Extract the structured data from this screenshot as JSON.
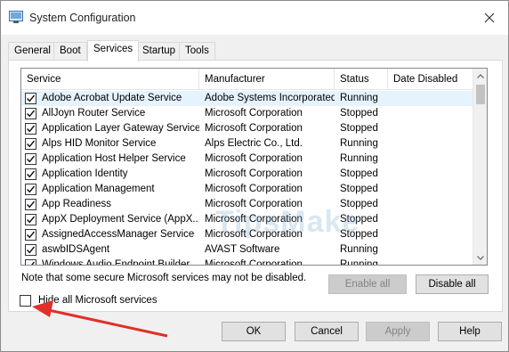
{
  "window": {
    "title": "System Configuration"
  },
  "tabs": [
    {
      "label": "General"
    },
    {
      "label": "Boot"
    },
    {
      "label": "Services",
      "active": true
    },
    {
      "label": "Startup"
    },
    {
      "label": "Tools"
    }
  ],
  "columns": [
    "Service",
    "Manufacturer",
    "Status",
    "Date Disabled"
  ],
  "services": [
    {
      "checked": true,
      "name": "Adobe Acrobat Update Service",
      "manufacturer": "Adobe Systems Incorporated",
      "status": "Running",
      "date_disabled": ""
    },
    {
      "checked": true,
      "name": "AllJoyn Router Service",
      "manufacturer": "Microsoft Corporation",
      "status": "Stopped",
      "date_disabled": ""
    },
    {
      "checked": true,
      "name": "Application Layer Gateway Service",
      "manufacturer": "Microsoft Corporation",
      "status": "Stopped",
      "date_disabled": ""
    },
    {
      "checked": true,
      "name": "Alps HID Monitor Service",
      "manufacturer": "Alps Electric Co., Ltd.",
      "status": "Running",
      "date_disabled": ""
    },
    {
      "checked": true,
      "name": "Application Host Helper Service",
      "manufacturer": "Microsoft Corporation",
      "status": "Running",
      "date_disabled": ""
    },
    {
      "checked": true,
      "name": "Application Identity",
      "manufacturer": "Microsoft Corporation",
      "status": "Stopped",
      "date_disabled": ""
    },
    {
      "checked": true,
      "name": "Application Management",
      "manufacturer": "Microsoft Corporation",
      "status": "Stopped",
      "date_disabled": ""
    },
    {
      "checked": true,
      "name": "App Readiness",
      "manufacturer": "Microsoft Corporation",
      "status": "Stopped",
      "date_disabled": ""
    },
    {
      "checked": true,
      "name": "AppX Deployment Service (AppX...",
      "manufacturer": "Microsoft Corporation",
      "status": "Stopped",
      "date_disabled": ""
    },
    {
      "checked": true,
      "name": "AssignedAccessManager Service",
      "manufacturer": "Microsoft Corporation",
      "status": "Stopped",
      "date_disabled": ""
    },
    {
      "checked": true,
      "name": "aswbIDSAgent",
      "manufacturer": "AVAST Software",
      "status": "Running",
      "date_disabled": ""
    },
    {
      "checked": true,
      "name": "Windows Audio Endpoint Builder",
      "manufacturer": "Microsoft Corporation",
      "status": "Running",
      "date_disabled": ""
    }
  ],
  "note": "Note that some secure Microsoft services may not be disabled.",
  "buttons": {
    "enable_all": "Enable all",
    "disable_all": "Disable all",
    "ok": "OK",
    "cancel": "Cancel",
    "apply": "Apply",
    "help": "Help"
  },
  "hide_ms": {
    "label": "Hide all Microsoft services",
    "checked": false
  },
  "watermark": "TipsMake",
  "colors": {
    "annotation_arrow": "#e0302a",
    "selected_row": "#e5f3ff"
  }
}
